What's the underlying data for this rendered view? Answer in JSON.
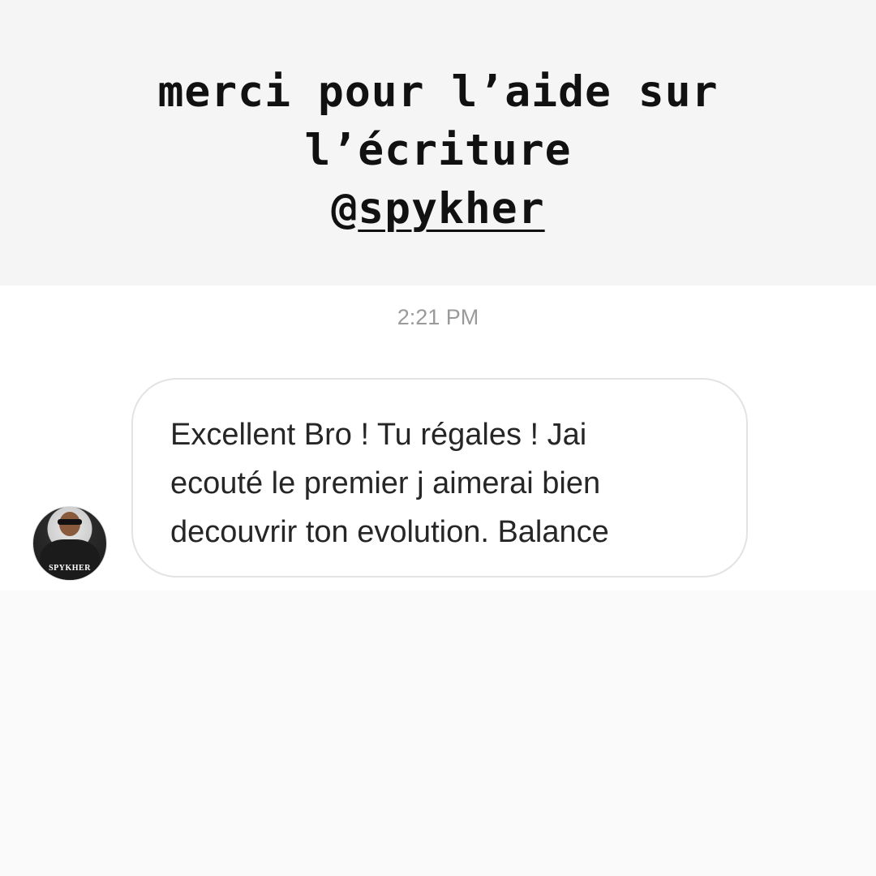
{
  "caption": {
    "line1": "merci pour l’aide sur",
    "line2": "l’écriture",
    "mention_at": "@",
    "mention_handle": "spykher"
  },
  "chat": {
    "timestamp": "2:21 PM",
    "avatar": {
      "label": "SPYKHER",
      "icon": "profile-photo"
    },
    "message": {
      "text": "Excellent Bro ! Tu régales !  Jai\necouté le premier j aimerai bien\ndecouvrir ton evolution. Balance"
    }
  },
  "colors": {
    "caption_background": "#f5f5f5",
    "chat_background": "#ffffff",
    "page_background": "#fafafa",
    "text": "#262626",
    "timestamp": "#9a9a9a",
    "bubble_border": "#e3e3e3"
  }
}
